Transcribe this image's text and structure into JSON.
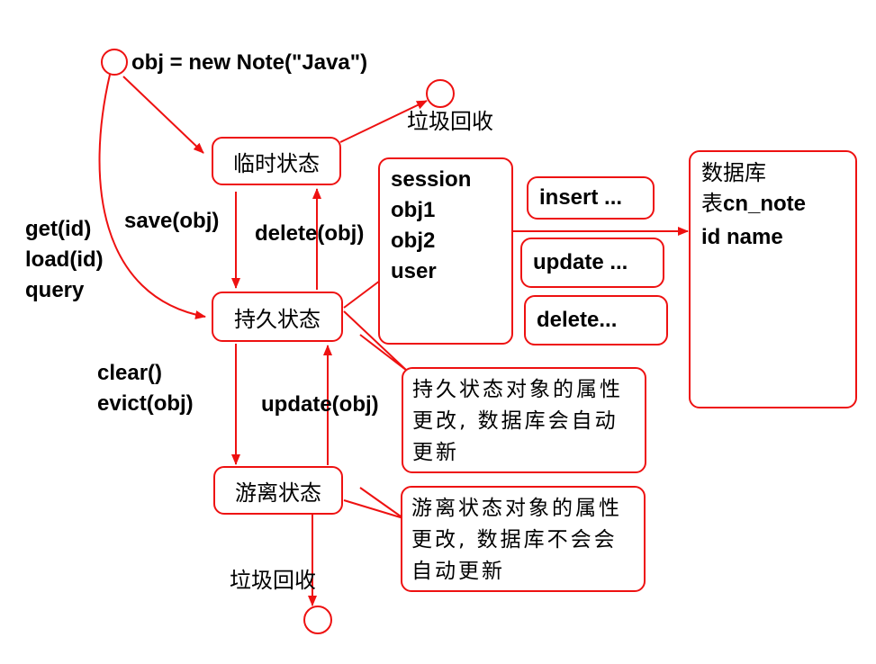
{
  "init": "obj = new Note(\"Java\")",
  "gc_top": "垃圾回收",
  "gc_bottom": "垃圾回收",
  "states": {
    "transient": "临时状态",
    "persistent": "持久状态",
    "detached": "游离状态"
  },
  "edges": {
    "save": "save(obj)",
    "delete": "delete(obj)",
    "get_lines": [
      "get(id)",
      "load(id)",
      "query"
    ],
    "clear_lines": [
      "clear()",
      "evict(obj)"
    ],
    "update": "update(obj)"
  },
  "session": {
    "lines": [
      "session",
      "obj1",
      "obj2",
      "user"
    ]
  },
  "ops": [
    "insert ...",
    "update ...",
    "delete..."
  ],
  "database": {
    "line1": "数据库",
    "table_prefix": "表",
    "table_name": "cn_note",
    "columns": "id name"
  },
  "notes": {
    "persistent": "持久状态对象的属性更改, 数据库会自动更新",
    "detached": "游离状态对象的属性更改, 数据库不会会自动更新"
  },
  "colors": {
    "stroke": "#ee1111",
    "text": "#000000",
    "background": "#ffffff"
  }
}
